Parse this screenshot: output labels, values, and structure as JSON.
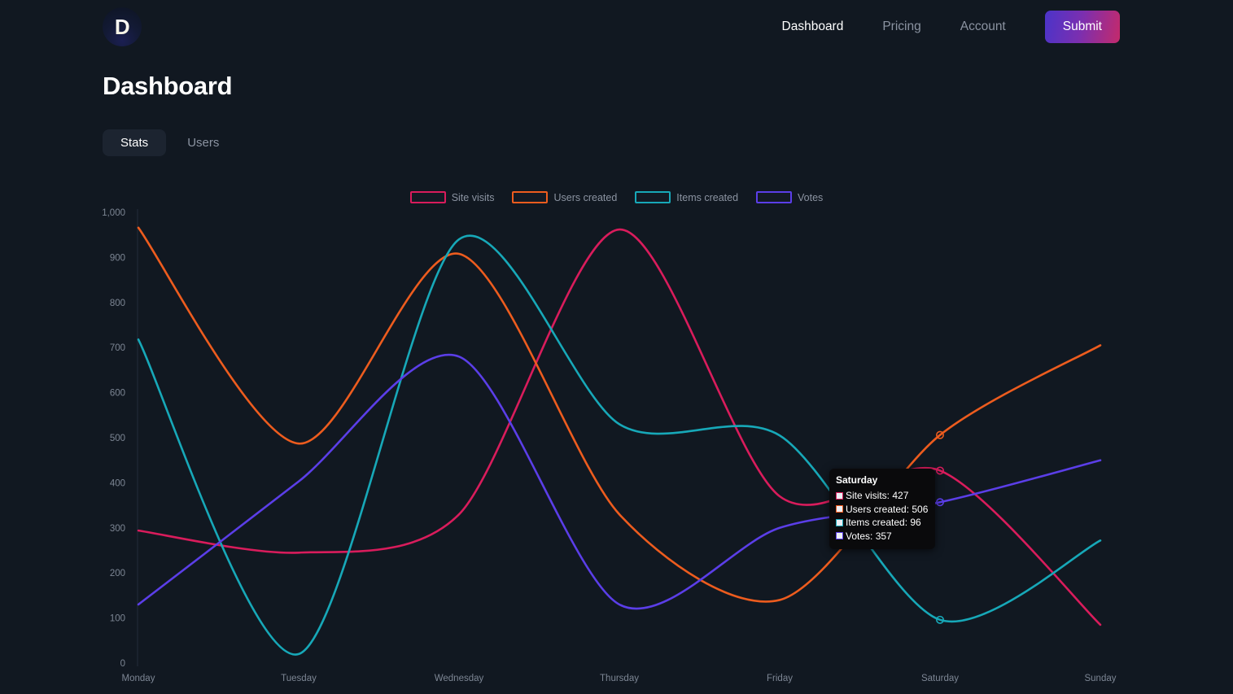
{
  "header": {
    "logo_letter": "D",
    "nav": [
      {
        "label": "Dashboard",
        "active": true
      },
      {
        "label": "Pricing",
        "active": false
      },
      {
        "label": "Account",
        "active": false
      }
    ],
    "submit_label": "Submit"
  },
  "page_title": "Dashboard",
  "tabs": [
    {
      "label": "Stats",
      "active": true
    },
    {
      "label": "Users",
      "active": false
    }
  ],
  "tooltip": {
    "title": "Saturday",
    "rows": [
      {
        "label": "Site visits: 427",
        "color": "#D91C5C"
      },
      {
        "label": "Users created: 506",
        "color": "#ED5C1E"
      },
      {
        "label": "Items created: 96",
        "color": "#17A8B8"
      },
      {
        "label": "Votes: 357",
        "color": "#5B3EE8"
      }
    ]
  },
  "colors": {
    "background": "#111821",
    "site_visits": "#D91C5C",
    "users_created": "#ED5C1E",
    "items_created": "#17A8B8",
    "votes": "#5B3EE8",
    "axis_text": "#7d8694",
    "accent_gradient_start": "#4b34c9",
    "accent_gradient_end": "#c42a6b"
  },
  "chart_data": {
    "type": "line",
    "title": "",
    "xlabel": "",
    "ylabel": "",
    "ylim": [
      0,
      1000
    ],
    "ytick_labels": [
      "1,000",
      "900",
      "800",
      "700",
      "600",
      "500",
      "400",
      "300",
      "200",
      "100",
      "0"
    ],
    "yticks": [
      1000,
      900,
      800,
      700,
      600,
      500,
      400,
      300,
      200,
      100,
      0
    ],
    "categories": [
      "Monday",
      "Tuesday",
      "Wednesday",
      "Thursday",
      "Friday",
      "Saturday",
      "Sunday"
    ],
    "grid": false,
    "legend_position": "top",
    "curve": "smooth",
    "highlight_category": "Saturday",
    "series": [
      {
        "name": "Site visits",
        "color": "#D91C5C",
        "values": [
          294,
          245,
          330,
          962,
          370,
          427,
          85
        ]
      },
      {
        "name": "Users created",
        "color": "#ED5C1E",
        "values": [
          966,
          487,
          908,
          330,
          140,
          506,
          705
        ]
      },
      {
        "name": "Items created",
        "color": "#17A8B8",
        "values": [
          718,
          20,
          940,
          530,
          505,
          96,
          272
        ]
      },
      {
        "name": "Votes",
        "color": "#5B3EE8",
        "values": [
          130,
          403,
          680,
          130,
          300,
          357,
          450
        ]
      }
    ]
  }
}
